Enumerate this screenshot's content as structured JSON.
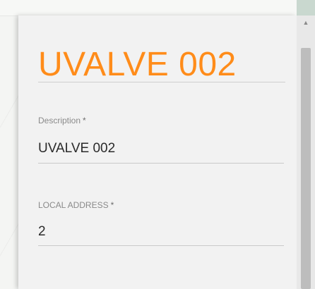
{
  "panel": {
    "title": "UVALVE 002",
    "fields": [
      {
        "label": "Description",
        "required_mark": "*",
        "value": "UVALVE 002"
      },
      {
        "label": "LOCAL ADDRESS",
        "required_mark": "*",
        "value": "2"
      }
    ]
  },
  "icons": {
    "scroll_up": "▲"
  },
  "colors": {
    "accent": "#ff8c1a",
    "panel_bg": "#f2f2f2"
  }
}
